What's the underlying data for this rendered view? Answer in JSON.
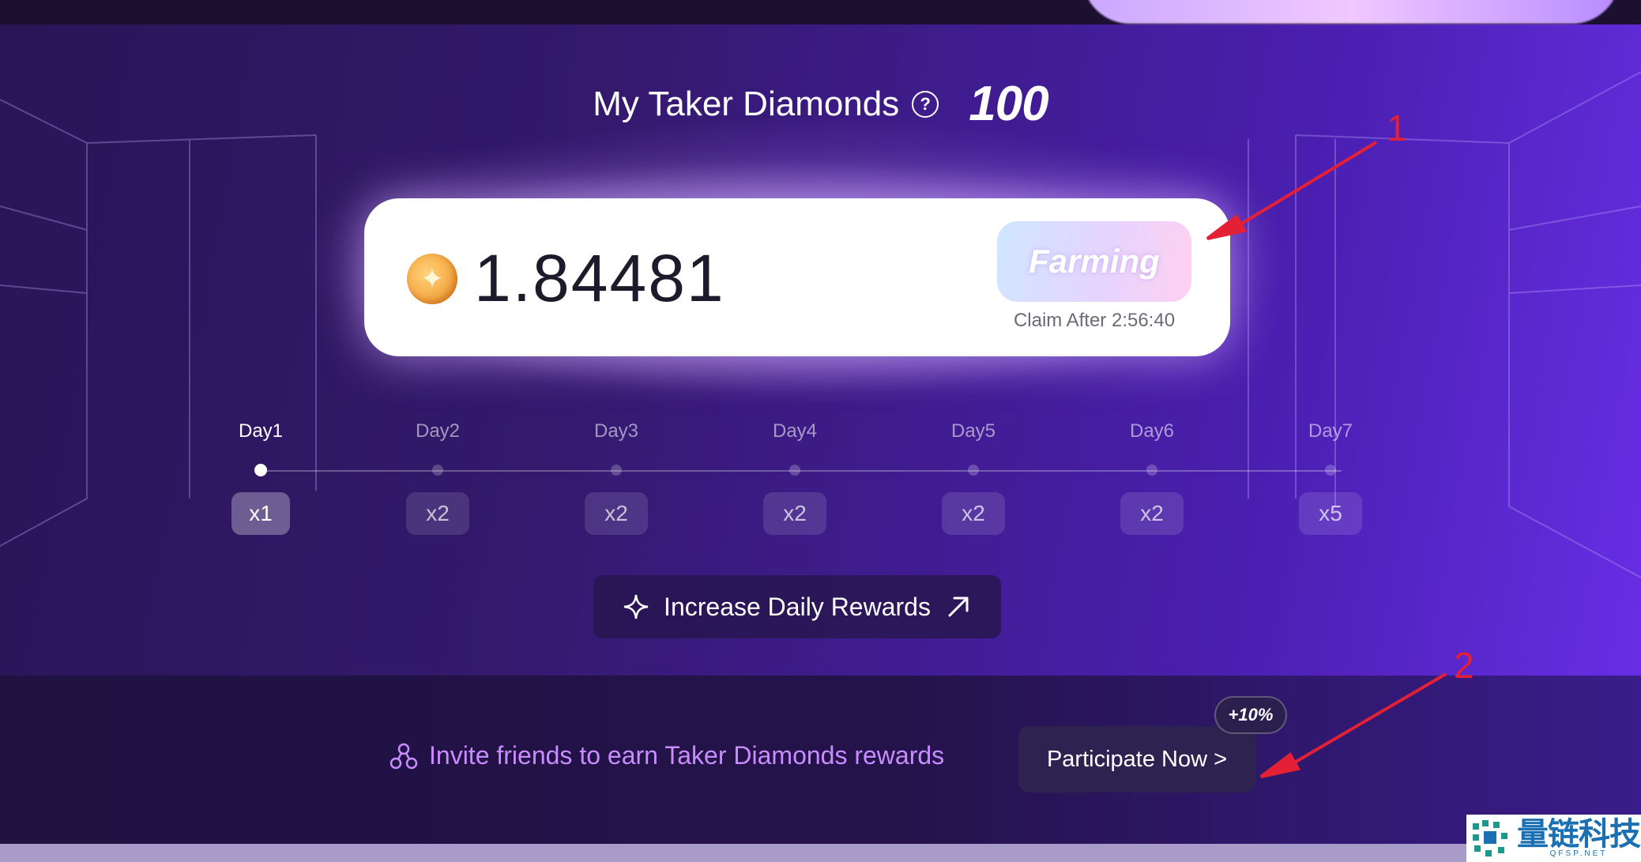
{
  "header": {
    "title": "My Taker Diamonds",
    "help_icon": "question-circle-icon",
    "total": "100"
  },
  "farm_card": {
    "coin_icon": "diamond-coin-icon",
    "amount": "1.84481",
    "farm_button": "Farming",
    "claim_text": "Claim After 2:56:40"
  },
  "streak": {
    "days": [
      {
        "label": "Day1",
        "multiplier": "x1",
        "active": true
      },
      {
        "label": "Day2",
        "multiplier": "x2",
        "active": false
      },
      {
        "label": "Day3",
        "multiplier": "x2",
        "active": false
      },
      {
        "label": "Day4",
        "multiplier": "x2",
        "active": false
      },
      {
        "label": "Day5",
        "multiplier": "x2",
        "active": false
      },
      {
        "label": "Day6",
        "multiplier": "x2",
        "active": false
      },
      {
        "label": "Day7",
        "multiplier": "x5",
        "active": false
      }
    ]
  },
  "increase_button": {
    "label": "Increase Daily Rewards",
    "left_icon": "sparkle-icon",
    "right_icon": "arrow-up-right-icon"
  },
  "invite": {
    "text": "Invite friends to earn Taker Diamonds rewards",
    "icon": "share-nodes-icon",
    "button": "Participate Now >",
    "bonus": "+10%"
  },
  "annotations": {
    "one": "1",
    "two": "2"
  },
  "watermark": {
    "cn": "量链科技",
    "en": "QFSP.NET"
  },
  "colors": {
    "accent_purple": "#6a2fe8",
    "invite_text": "#c98cff",
    "annotation_red": "#e32036"
  }
}
